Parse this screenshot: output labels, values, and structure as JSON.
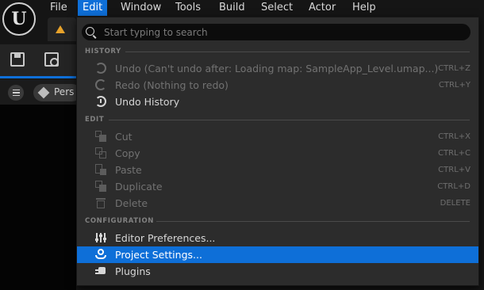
{
  "menubar": {
    "logo_letter": "U",
    "items": [
      "File",
      "Edit",
      "Window",
      "Tools",
      "Build",
      "Select",
      "Actor",
      "Help"
    ],
    "active": "Edit"
  },
  "outliner": {
    "chip_label": "Pers"
  },
  "menu": {
    "search_placeholder": "Start typing to search",
    "sections": {
      "history": "HISTORY",
      "edit": "EDIT",
      "configuration": "CONFIGURATION"
    },
    "history_items": [
      {
        "label": "Undo (Can't undo after: Loading map: SampleApp_Level.umap...)",
        "shortcut": "CTRL+Z",
        "icon": "undo-icon"
      },
      {
        "label": "Redo (Nothing to redo)",
        "shortcut": "CTRL+Y",
        "icon": "redo-icon"
      },
      {
        "label": "Undo History",
        "shortcut": "",
        "icon": "history-icon"
      }
    ],
    "edit_items": [
      {
        "label": "Cut",
        "shortcut": "CTRL+X",
        "icon": "cut-icon"
      },
      {
        "label": "Copy",
        "shortcut": "CTRL+C",
        "icon": "copy-icon"
      },
      {
        "label": "Paste",
        "shortcut": "CTRL+V",
        "icon": "paste-icon"
      },
      {
        "label": "Duplicate",
        "shortcut": "CTRL+D",
        "icon": "duplicate-icon"
      },
      {
        "label": "Delete",
        "shortcut": "DELETE",
        "icon": "trash-icon"
      }
    ],
    "config_items": [
      {
        "label": "Editor Preferences...",
        "icon": "sliders-icon"
      },
      {
        "label": "Project Settings...",
        "icon": "project-settings-icon"
      },
      {
        "label": "Plugins",
        "icon": "plug-icon"
      }
    ]
  },
  "colors": {
    "accent": "#0e6fd8",
    "menu_bg": "#2c2c2c",
    "tab_icon": "#e7a22a"
  }
}
